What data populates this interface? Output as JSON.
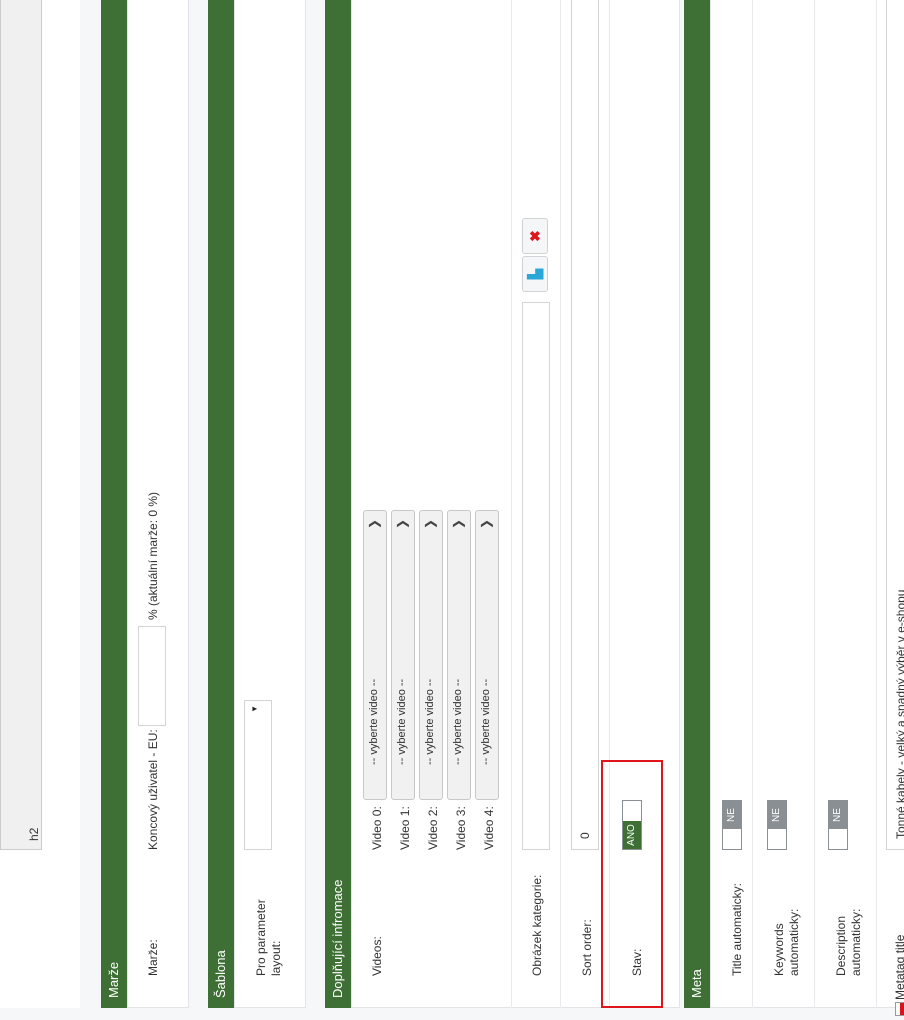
{
  "top_field": {
    "value": "h2"
  },
  "marze": {
    "header": "Marže",
    "label": "Marže:",
    "sub_label": "Koncový uživatel - EU:",
    "value": "",
    "note": "% (aktuální marže: 0  %)"
  },
  "sablona": {
    "header": "Šablona",
    "label": "Pro parameter layout:"
  },
  "doplnujici": {
    "header": "Doplňující infromace",
    "videos_label": "Videos:",
    "videos": [
      {
        "label": "Video 0:",
        "selected": "-- vyberte video --"
      },
      {
        "label": "Video 1:",
        "selected": "-- vyberte video --"
      },
      {
        "label": "Video 2:",
        "selected": "-- vyberte video --"
      },
      {
        "label": "Video 3:",
        "selected": "-- vyberte video --"
      },
      {
        "label": "Video 4:",
        "selected": "-- vyberte video --"
      }
    ],
    "obrazek_label": "Obrázek kategorie:",
    "sort_label": "Sort order:",
    "sort_value": "0",
    "stav_label": "Stav:",
    "stav_on": "ANO",
    "stav_off": ""
  },
  "meta": {
    "header": "Meta",
    "title_auto_label": "Title automaticky:",
    "keywords_auto_label": "Keywords automaticky:",
    "description_auto_label": "Description automaticky:",
    "toggle_off_label": "NE",
    "metatag_title_label": "Metatag title",
    "metatag_title_value": "Tonné kabely - velký a snadný výběr v e-shopu"
  },
  "colors": {
    "accent": "#3e7035",
    "highlight": "#e0141c",
    "toggle_off": "#8a8f94"
  }
}
